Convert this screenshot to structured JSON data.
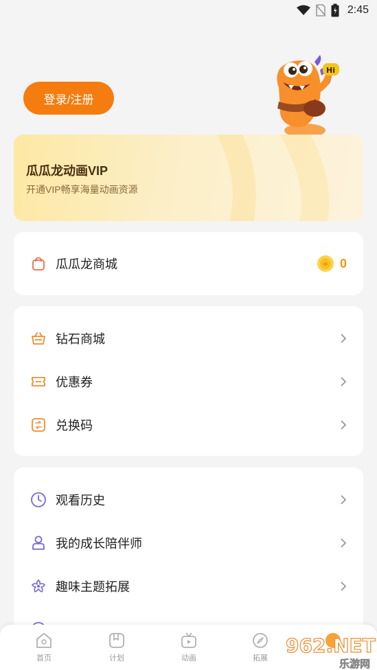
{
  "status_bar": {
    "time": "2:45",
    "icons": [
      "wifi-icon",
      "no-sim-icon",
      "battery-icon"
    ]
  },
  "header": {
    "login_label": "登录/注册"
  },
  "vip": {
    "title": "瓜瓜龙动画VIP",
    "subtitle": "开通VIP畅享海量动画资源"
  },
  "shop_card": {
    "label": "瓜瓜龙商城",
    "coin_count": "0"
  },
  "store_card": {
    "items": [
      {
        "label": "钻石商城",
        "icon": "basket-icon"
      },
      {
        "label": "优惠券",
        "icon": "coupon-icon"
      },
      {
        "label": "兑换码",
        "icon": "redeem-code-icon"
      }
    ]
  },
  "more_card": {
    "items": [
      {
        "label": "观看历史",
        "icon": "clock-icon"
      },
      {
        "label": "我的成长陪伴师",
        "icon": "person-icon"
      },
      {
        "label": "趣味主题拓展",
        "icon": "flower-icon"
      }
    ]
  },
  "tab_bar": {
    "tabs": [
      {
        "label": "首页",
        "icon": "home-icon"
      },
      {
        "label": "计划",
        "icon": "plan-icon"
      },
      {
        "label": "动画",
        "icon": "tv-icon"
      },
      {
        "label": "拓展",
        "icon": "compass-icon"
      },
      {
        "label": "",
        "icon": "profile-icon"
      }
    ]
  },
  "watermark": {
    "text": "962.NET",
    "subtext": "乐游网"
  },
  "colors": {
    "accent": "#f57c0e",
    "background": "#f4f4f4",
    "card": "#ffffff",
    "coin": "#f5950e"
  }
}
